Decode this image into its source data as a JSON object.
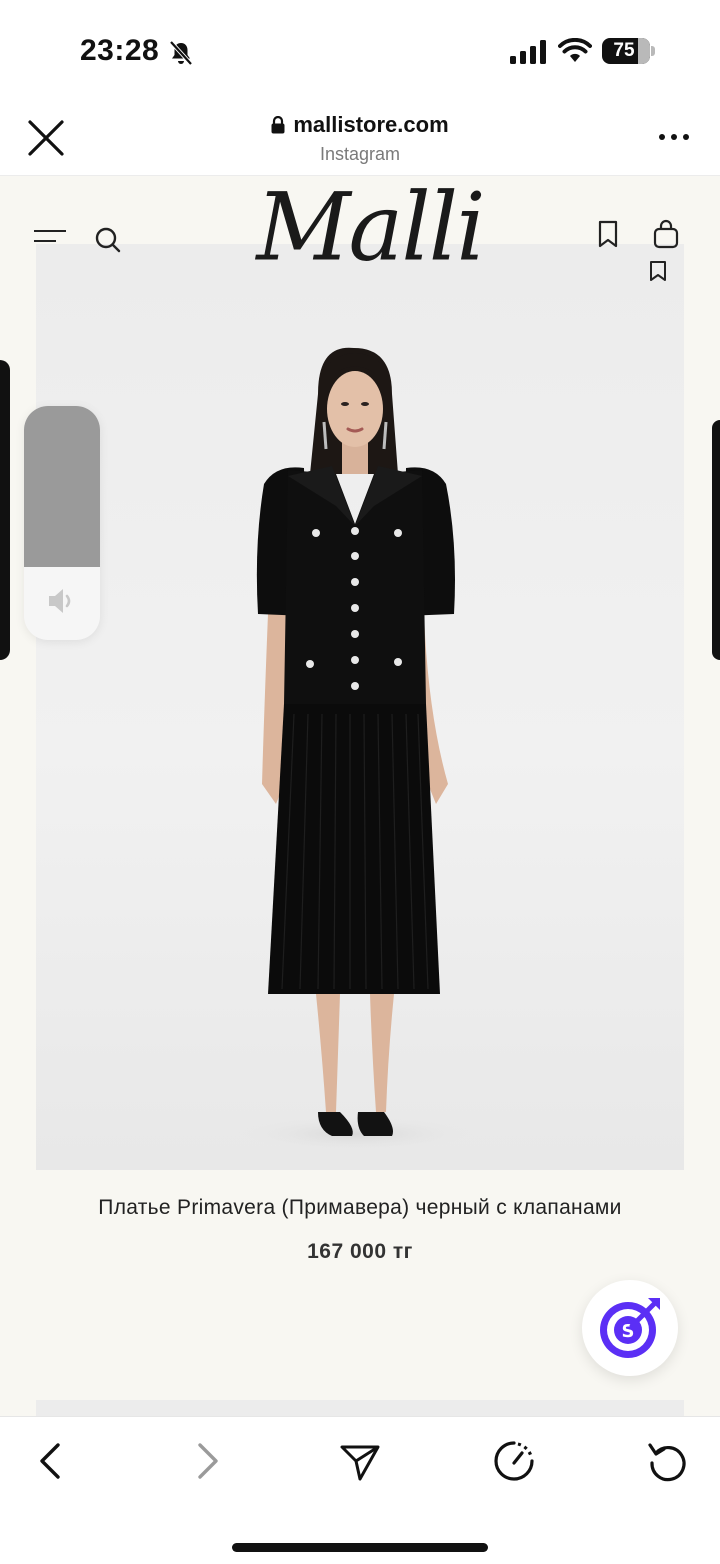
{
  "status_bar": {
    "time": "23:28",
    "battery_percent": "75",
    "battery_level": 0.75,
    "icons": [
      "bell-off-icon",
      "cellular-signal-icon",
      "wifi-icon",
      "battery-icon"
    ]
  },
  "browser": {
    "domain": "mallistore.com",
    "source_label": "Instagram",
    "icons": [
      "close-icon",
      "lock-icon",
      "more-icon"
    ]
  },
  "site_header": {
    "logo_text": "Malli",
    "icons": [
      "menu-icon",
      "search-icon",
      "bookmark-icon",
      "bag-icon",
      "wishlist-icon"
    ]
  },
  "product": {
    "title": "Платье Primavera (Примавера) черный с клапанами",
    "price": "167 000 тг"
  },
  "volume": {
    "level": 0.31,
    "icon": "speaker-icon"
  },
  "toolbar": {
    "icons": [
      "back-icon",
      "forward-icon",
      "share-icon",
      "timer-icon",
      "reload-icon"
    ]
  },
  "colors": {
    "page_background": "#f8f7f2",
    "image_background": "#ececec",
    "widget_purple": "#5b2ff5",
    "text_primary": "#222222"
  }
}
